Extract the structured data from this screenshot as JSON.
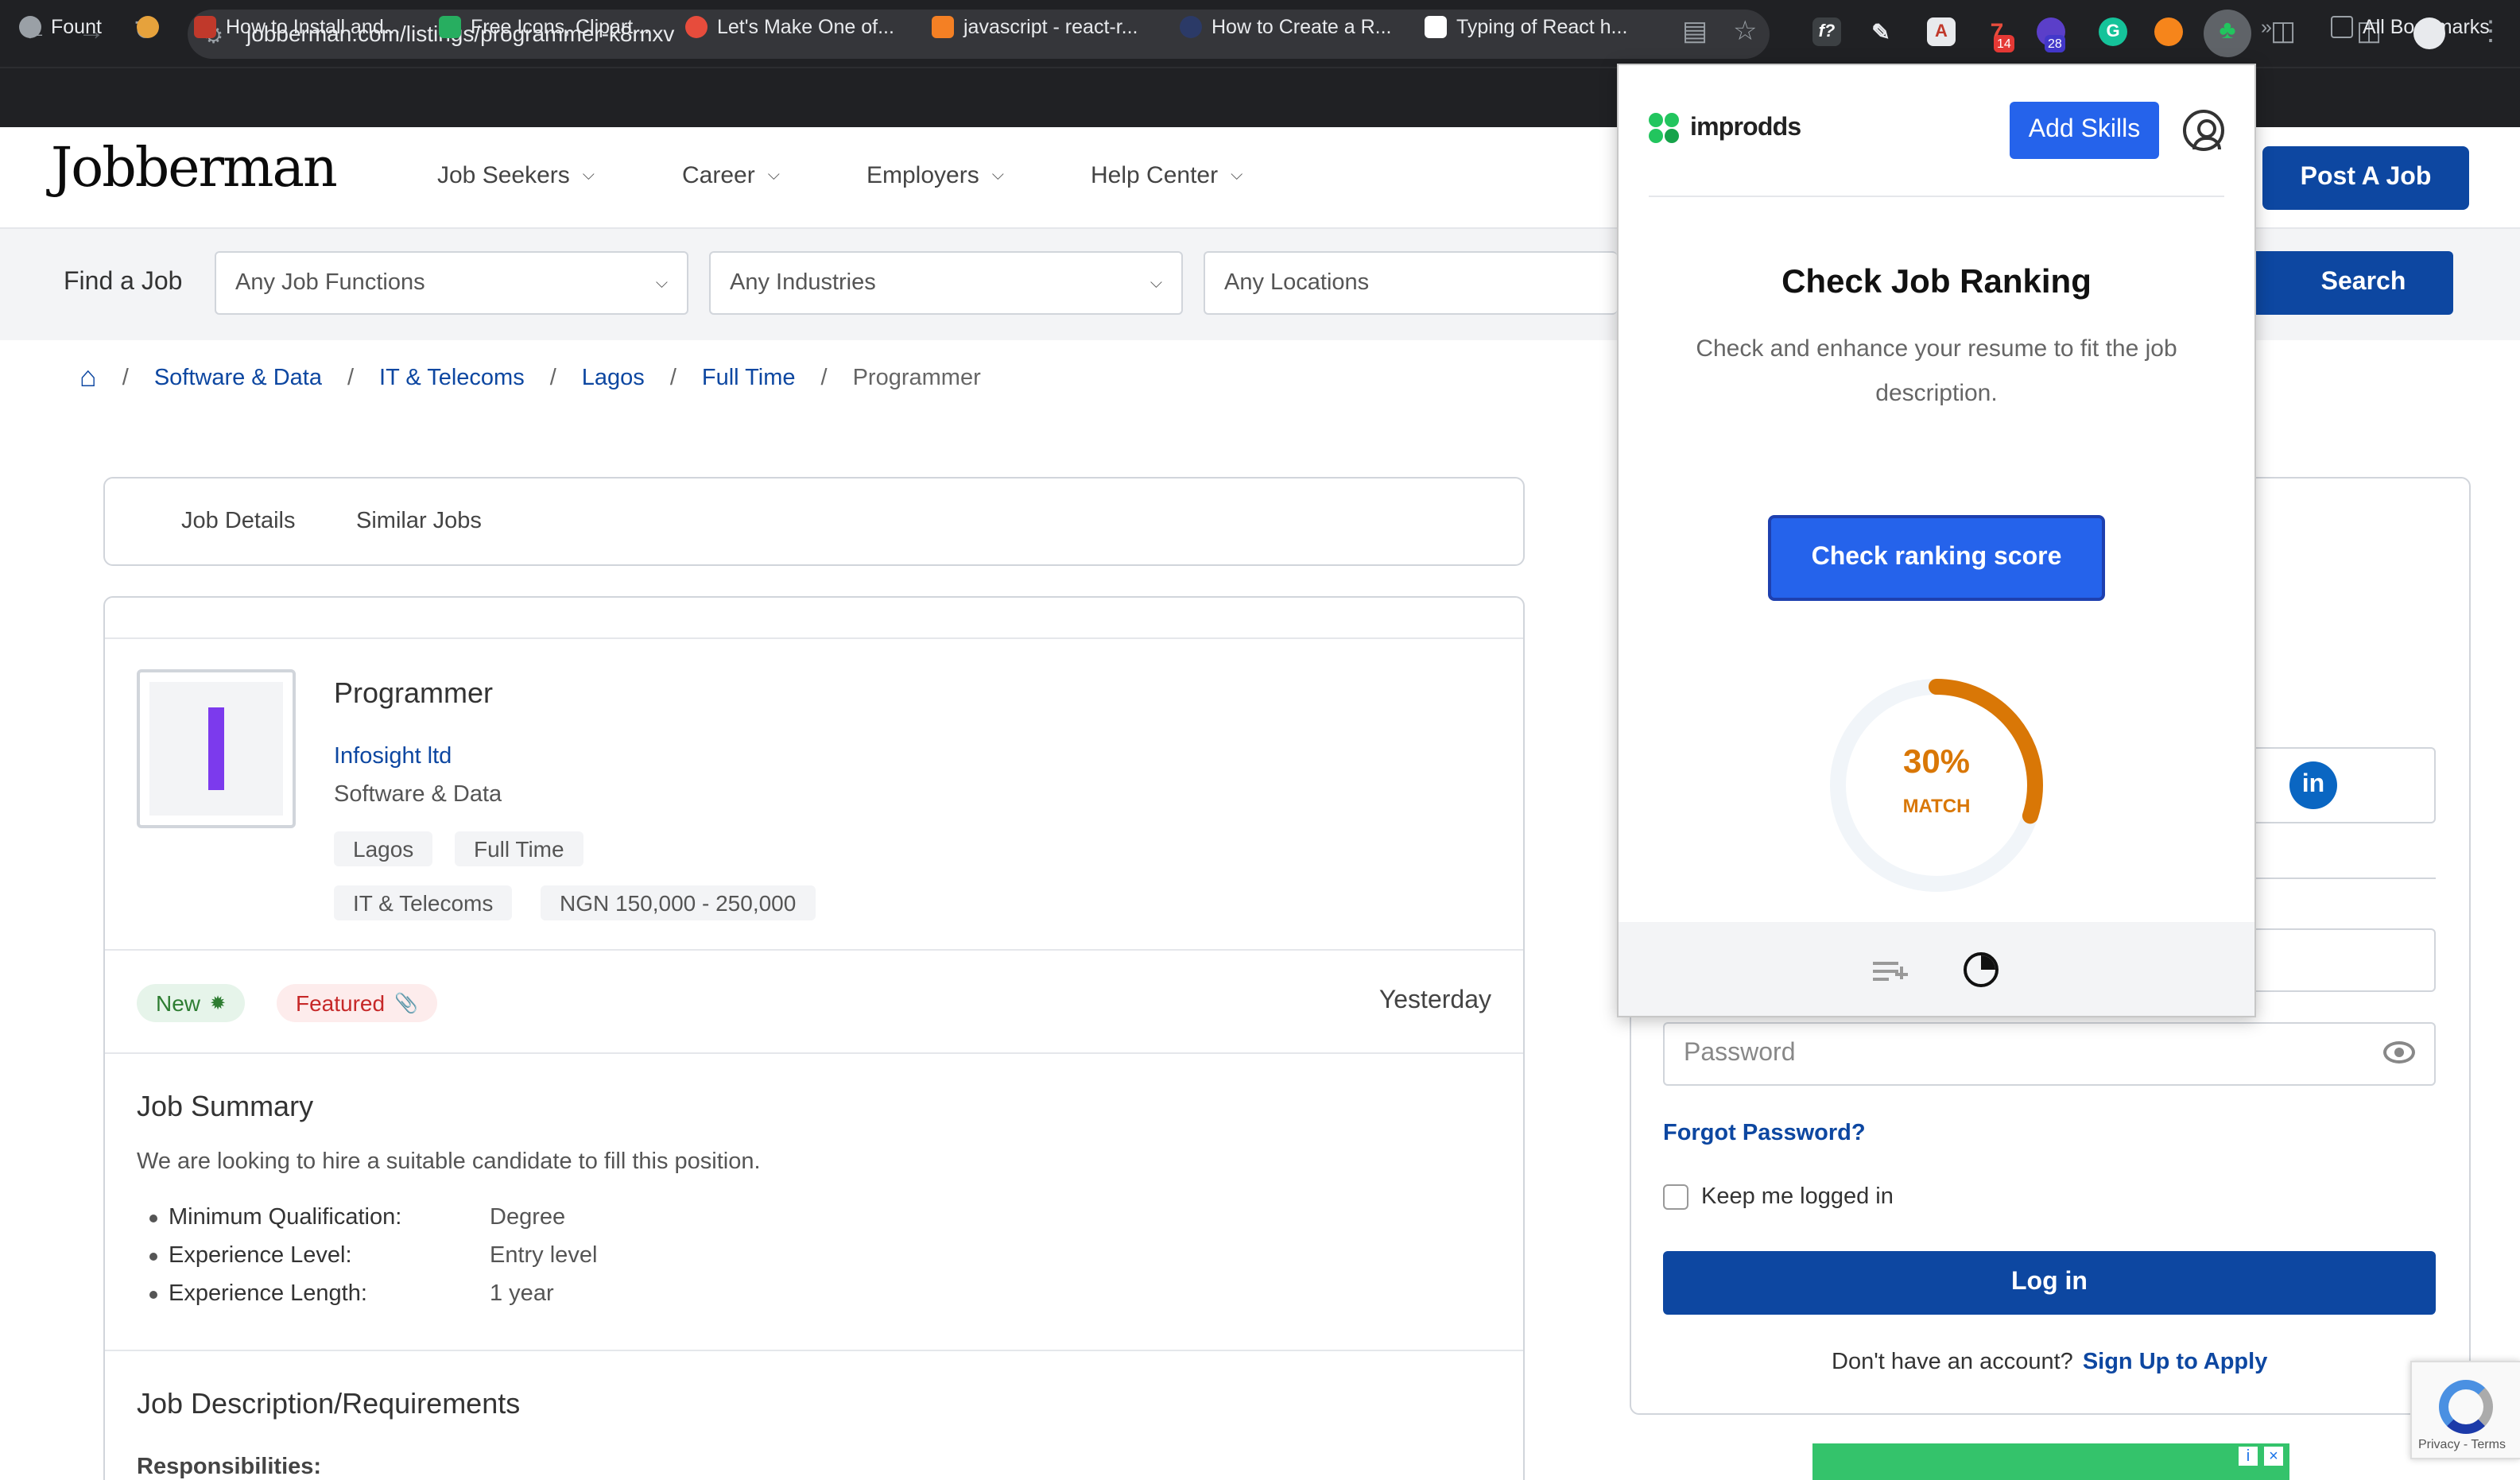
{
  "browser": {
    "url": "jobberman.com/listings/programmer-k8rnxv",
    "ext_badges": [
      "14",
      "28"
    ],
    "bookmarks": [
      {
        "label": "Fount",
        "color": "#9aa0a6"
      },
      {
        "label": "",
        "color": "#e6a23c"
      },
      {
        "label": "How to Install and...",
        "color": "#c0392b"
      },
      {
        "label": "Free Icons, Clipart...",
        "color": "#27ae60"
      },
      {
        "label": "Let's Make One of...",
        "color": "#e74c3c"
      },
      {
        "label": "javascript - react-r...",
        "color": "#f48024"
      },
      {
        "label": "How to Create a R...",
        "color": "#2b3a67"
      },
      {
        "label": "Typing of React h...",
        "color": "#ffffff"
      }
    ],
    "all_bookmarks": "All Bookmarks"
  },
  "site": {
    "logo": "Jobberman",
    "nav": [
      "Job Seekers",
      "Career",
      "Employers",
      "Help Center"
    ],
    "post_job": "Post A Job"
  },
  "search": {
    "label": "Find a Job",
    "functions": "Any Job Functions",
    "industries": "Any Industries",
    "locations": "Any Locations",
    "button": "Search"
  },
  "breadcrumb": [
    "Software & Data",
    "IT & Telecoms",
    "Lagos",
    "Full Time",
    "Programmer"
  ],
  "tabs": [
    "Job Details",
    "Similar Jobs"
  ],
  "job": {
    "title": "Programmer",
    "company": "Infosight ltd",
    "industry": "Software & Data",
    "tags_row1": [
      "Lagos",
      "Full Time"
    ],
    "tags_row2": [
      "IT & Telecoms",
      "NGN 150,000 - 250,000"
    ],
    "badge_new": "New",
    "badge_featured": "Featured",
    "posted": "Yesterday",
    "summary_title": "Job Summary",
    "summary_text": "We are looking to hire a suitable candidate to fill this position.",
    "qualifications": [
      {
        "key": "Minimum Qualification:",
        "value": "Degree"
      },
      {
        "key": "Experience Level:",
        "value": "Entry level"
      },
      {
        "key": "Experience Length:",
        "value": "1 year"
      }
    ],
    "desc_title": "Job Description/Requirements",
    "responsibilities": "Responsibilities:"
  },
  "login": {
    "password_placeholder": "Password",
    "forgot": "Forgot Password?",
    "keep_logged": "Keep me logged in",
    "button": "Log in",
    "no_account": "Don't have an account?",
    "signup": "Sign Up to Apply",
    "recaptcha": "Privacy - Terms"
  },
  "popup": {
    "brand": "improdds",
    "add_skills": "Add Skills",
    "title": "Check Job Ranking",
    "subtitle": "Check and enhance your resume to fit the job description.",
    "rank_button": "Check ranking score",
    "match_pct": "30%",
    "match_value": 30,
    "match_label": "MATCH",
    "accent": "#d97706"
  }
}
